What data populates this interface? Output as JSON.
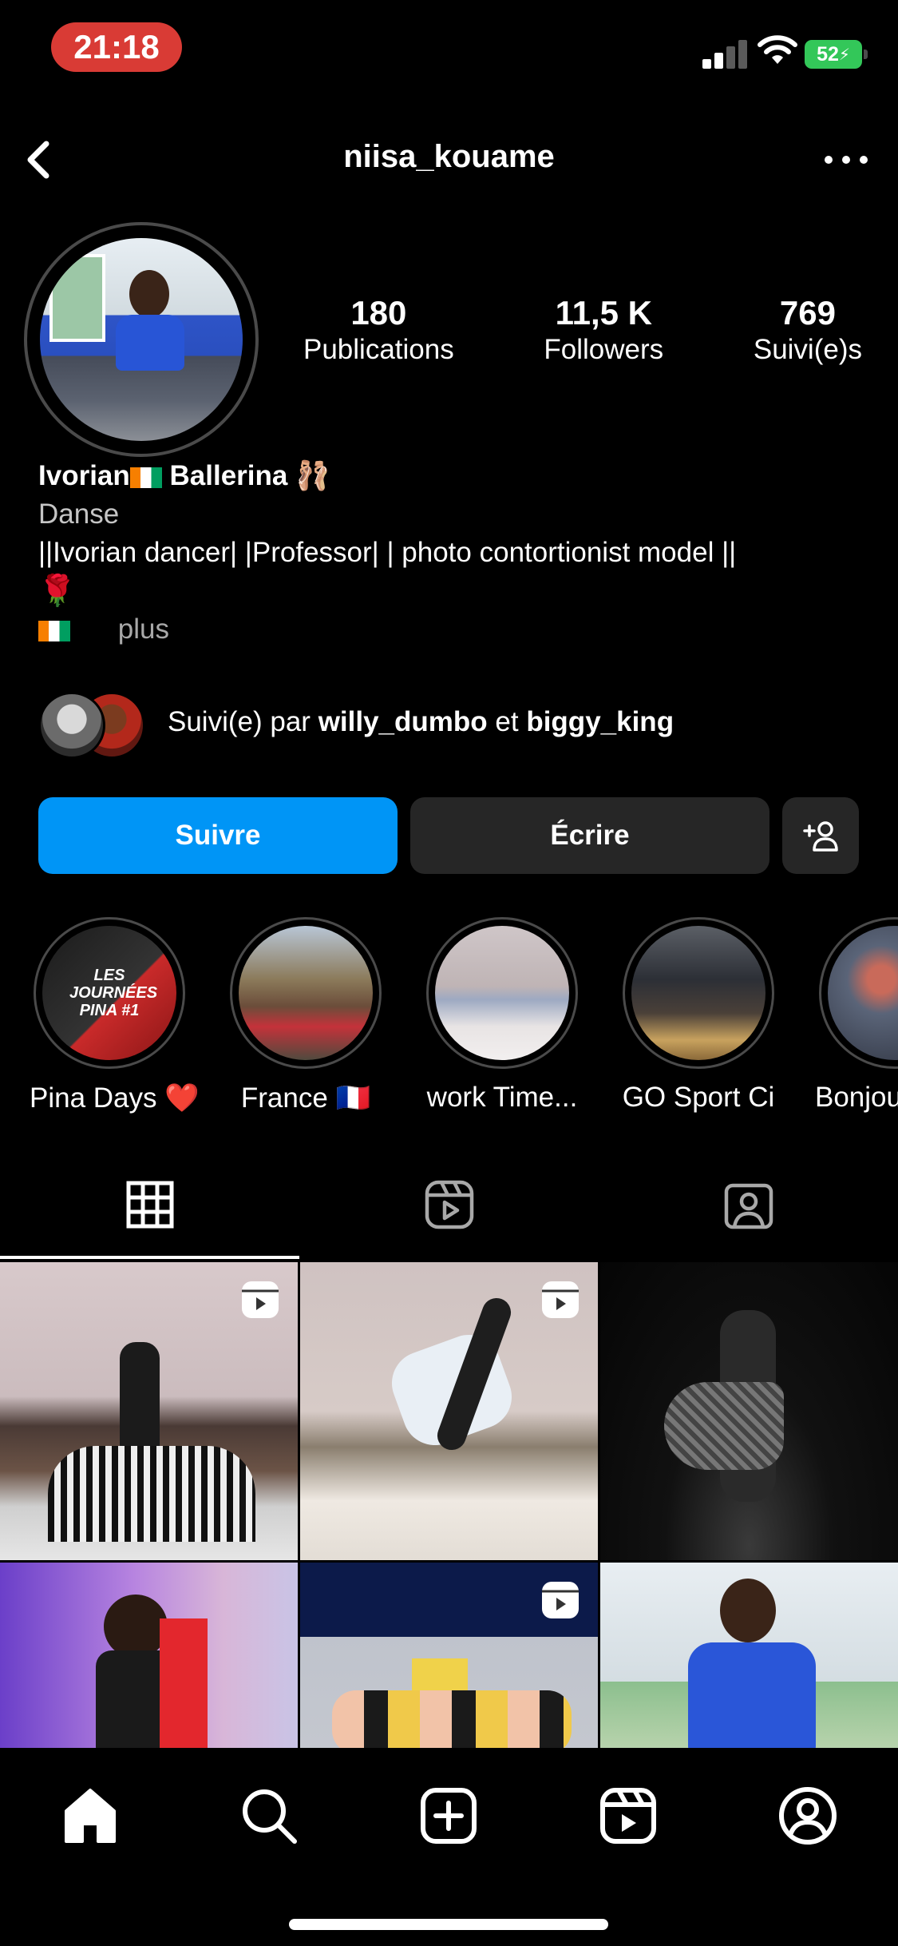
{
  "status_bar": {
    "time": "21:18",
    "battery": "52"
  },
  "header": {
    "username": "niisa_kouame"
  },
  "profile": {
    "stats": [
      {
        "value": "180",
        "label": "Publications"
      },
      {
        "value": "11,5 K",
        "label": "Followers"
      },
      {
        "value": "769",
        "label": "Suivi(e)s"
      }
    ],
    "name_part1": "Ivorian",
    "name_part2": "Ballerina",
    "name_emoji": "🩰",
    "category": "Danse",
    "bio_line": "||Ivorian dancer| |Professor| | photo contortionist model ||",
    "bio_emoji": "🌹",
    "more_link": "plus"
  },
  "followed_by": {
    "prefix": "Suivi(e) par",
    "user1": "willy_dumbo",
    "conj": "et",
    "user2": "biggy_king"
  },
  "buttons": {
    "follow": "Suivre",
    "message": "Écrire"
  },
  "highlights": [
    {
      "label": "Pina Days ❤️"
    },
    {
      "label": "France 🇫🇷"
    },
    {
      "label": "work Time..."
    },
    {
      "label": "GO Sport Ci"
    },
    {
      "label": "Bonjou"
    }
  ],
  "highlight_cover_text": "LES JOURNÉES PINA #1",
  "colors": {
    "accent": "#0095f6",
    "dark_button": "#262626",
    "background": "#000000",
    "time_pill": "#d93b35",
    "battery": "#33c759"
  }
}
